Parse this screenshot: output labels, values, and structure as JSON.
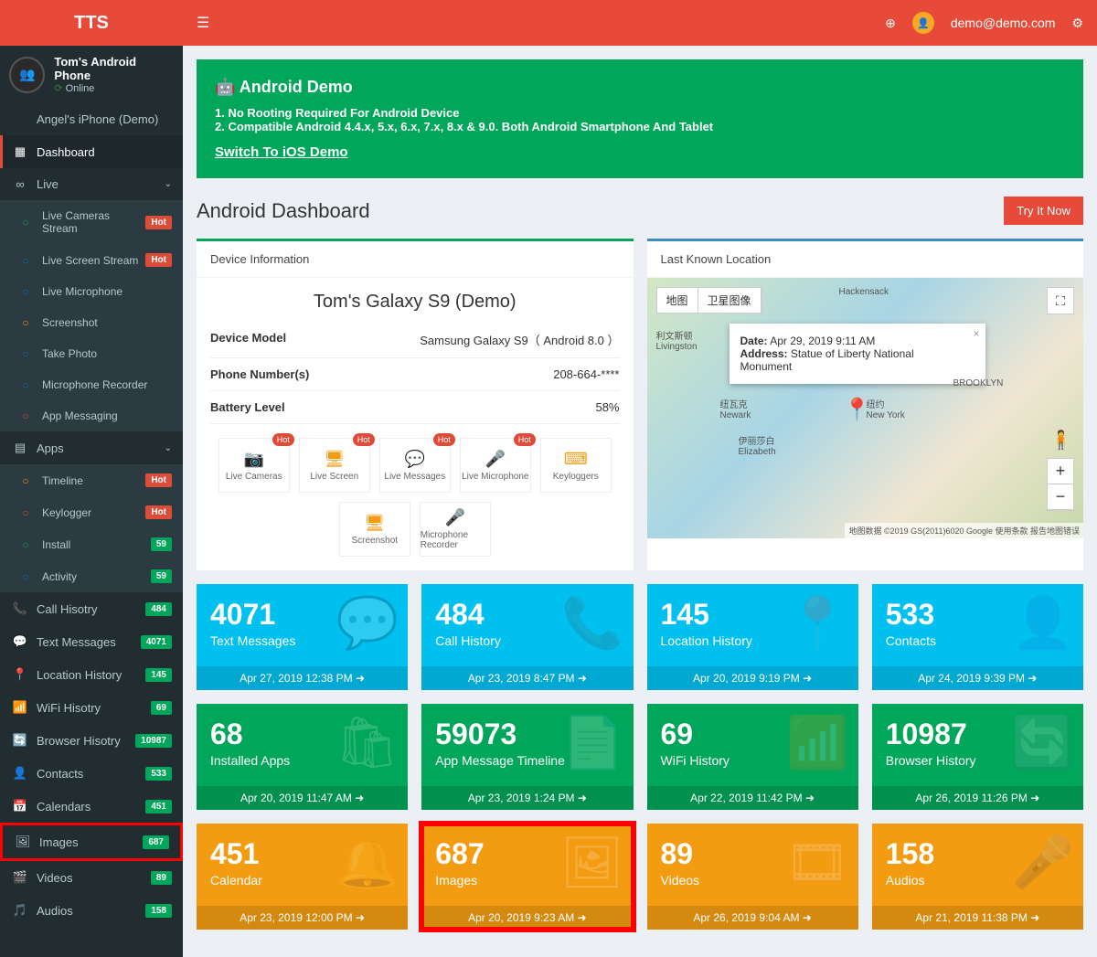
{
  "header": {
    "logo": "TTS",
    "user_email": "demo@demo.com"
  },
  "sidebar": {
    "user": {
      "name": "Tom's Android Phone",
      "status": "Online"
    },
    "demo_device": "Angel's iPhone (Demo)",
    "dashboard": "Dashboard",
    "live": {
      "label": "Live",
      "items": [
        {
          "lbl": "Live Cameras Stream",
          "badge": "Hot",
          "bcls": "bg-red",
          "ic": "bg-g"
        },
        {
          "lbl": "Live Screen Stream",
          "badge": "Hot",
          "bcls": "bg-red",
          "ic": "bg-b"
        },
        {
          "lbl": "Live Microphone",
          "ic": "bg-b"
        },
        {
          "lbl": "Screenshot",
          "ic": "bg-o"
        },
        {
          "lbl": "Take Photo",
          "ic": "bg-b"
        },
        {
          "lbl": "Microphone Recorder",
          "ic": "bg-b"
        },
        {
          "lbl": "App Messaging",
          "ic": "bg-r"
        }
      ]
    },
    "apps": {
      "label": "Apps",
      "items": [
        {
          "lbl": "Timeline",
          "badge": "Hot",
          "bcls": "bg-red",
          "ic": "bg-o"
        },
        {
          "lbl": "Keylogger",
          "badge": "Hot",
          "bcls": "bg-red",
          "ic": "bg-r"
        },
        {
          "lbl": "Install",
          "badge": "59",
          "bcls": "bg-green",
          "ic": "bg-g"
        },
        {
          "lbl": "Activity",
          "badge": "59",
          "bcls": "bg-green",
          "ic": "bg-b"
        }
      ]
    },
    "rest": [
      {
        "lbl": "Call Hisotry",
        "badge": "484",
        "ic": "📞"
      },
      {
        "lbl": "Text Messages",
        "badge": "4071",
        "ic": "💬"
      },
      {
        "lbl": "Location History",
        "badge": "145",
        "ic": "📍"
      },
      {
        "lbl": "WiFi Hisotry",
        "badge": "69",
        "ic": "📶"
      },
      {
        "lbl": "Browser Hisotry",
        "badge": "10987",
        "ic": "🔄"
      },
      {
        "lbl": "Contacts",
        "badge": "533",
        "ic": "👤"
      },
      {
        "lbl": "Calendars",
        "badge": "451",
        "ic": "📅"
      },
      {
        "lbl": "Images",
        "badge": "687",
        "ic": "🖼",
        "hl": true
      },
      {
        "lbl": "Videos",
        "badge": "89",
        "ic": "🎬"
      },
      {
        "lbl": "Audios",
        "badge": "158",
        "ic": "🎵"
      }
    ]
  },
  "banner": {
    "title": "Android Demo",
    "line1": "1. No Rooting Required For Android Device",
    "line2": "2. Compatible Android 4.4.x, 5.x, 6.x, 7.x, 8.x & 9.0. Both Android Smartphone And Tablet",
    "link": "Switch To iOS Demo"
  },
  "dash": {
    "title": "Android Dashboard",
    "btn": "Try It Now"
  },
  "device_panel": {
    "header": "Device Information",
    "name": "Tom's Galaxy S9 (Demo)",
    "rows": [
      {
        "k": "Device Model",
        "v": "Samsung Galaxy S9（ Android 8.0 ）"
      },
      {
        "k": "Phone Number(s)",
        "v": "208-664-****"
      },
      {
        "k": "Battery Level",
        "v": "58%"
      }
    ],
    "shortcuts": [
      {
        "lbl": "Live Cameras",
        "hot": "Hot",
        "ic": "📷"
      },
      {
        "lbl": "Live Screen",
        "hot": "Hot",
        "ic": "🖥"
      },
      {
        "lbl": "Live Messages",
        "hot": "Hot",
        "ic": "💬"
      },
      {
        "lbl": "Live Microphone",
        "hot": "Hot",
        "ic": "🎤"
      },
      {
        "lbl": "Keyloggers",
        "ic": "⌨"
      },
      {
        "lbl": "Screenshot",
        "ic": "🖥"
      },
      {
        "lbl": "Microphone Recorder",
        "ic": "🎤"
      }
    ]
  },
  "map_panel": {
    "header": "Last Known Location",
    "tab1": "地图",
    "tab2": "卫星图像",
    "date_lbl": "Date:",
    "date": "Apr 29, 2019 9:11 AM",
    "addr_lbl": "Address:",
    "addr": "Statue of Liberty National Monument",
    "attr": "地图数据 ©2019 GS(2011)6020 Google  使用条款  报告地图错误"
  },
  "tiles1": [
    {
      "n": "4071",
      "l": "Text Messages",
      "f": "Apr 27, 2019 12:38 PM",
      "c": "blue",
      "ic": "💬"
    },
    {
      "n": "484",
      "l": "Call History",
      "f": "Apr 23, 2019 8:47 PM",
      "c": "blue",
      "ic": "📞"
    },
    {
      "n": "145",
      "l": "Location History",
      "f": "Apr 20, 2019 9:19 PM",
      "c": "blue",
      "ic": "📍"
    },
    {
      "n": "533",
      "l": "Contacts",
      "f": "Apr 24, 2019 9:39 PM",
      "c": "blue",
      "ic": "👤"
    }
  ],
  "tiles2": [
    {
      "n": "68",
      "l": "Installed Apps",
      "f": "Apr 20, 2019 11:47 AM",
      "c": "green",
      "ic": "🛍"
    },
    {
      "n": "59073",
      "l": "App Message Timeline",
      "f": "Apr 23, 2019 1:24 PM",
      "c": "green",
      "ic": "📄"
    },
    {
      "n": "69",
      "l": "WiFi History",
      "f": "Apr 22, 2019 11:42 PM",
      "c": "green",
      "ic": "📶"
    },
    {
      "n": "10987",
      "l": "Browser History",
      "f": "Apr 26, 2019 11:26 PM",
      "c": "green",
      "ic": "🔄"
    }
  ],
  "tiles3": [
    {
      "n": "451",
      "l": "Calendar",
      "f": "Apr 23, 2019 12:00 PM",
      "c": "orange",
      "ic": "🔔"
    },
    {
      "n": "687",
      "l": "Images",
      "f": "Apr 20, 2019 9:23 AM",
      "c": "orange",
      "ic": "🖼",
      "hl": true
    },
    {
      "n": "89",
      "l": "Videos",
      "f": "Apr 26, 2019 9:04 AM",
      "c": "orange",
      "ic": "🎞"
    },
    {
      "n": "158",
      "l": "Audios",
      "f": "Apr 21, 2019 11:38 PM",
      "c": "orange",
      "ic": "🎤"
    }
  ]
}
